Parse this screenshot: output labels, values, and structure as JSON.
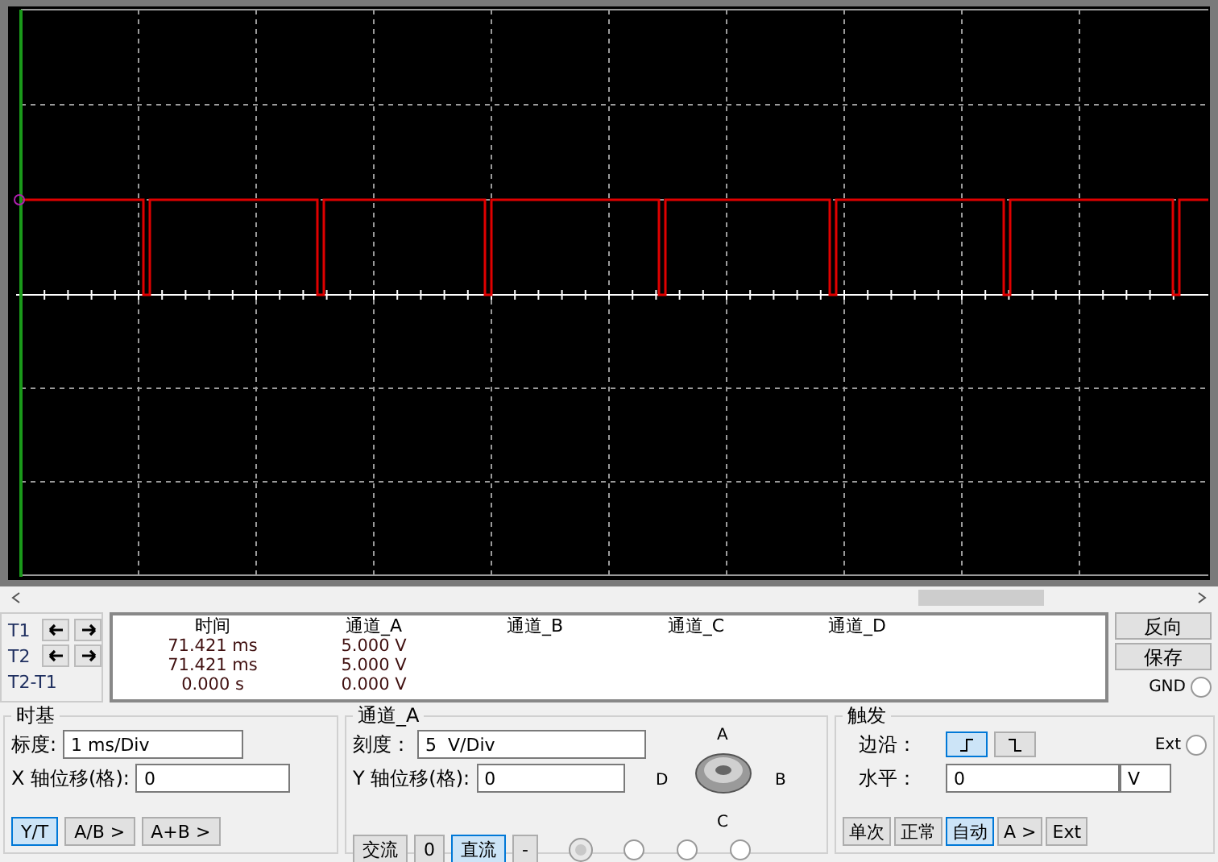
{
  "readout": {
    "columns": [
      "时间",
      "通道_A",
      "通道_B",
      "通道_C",
      "通道_D"
    ],
    "rows": [
      {
        "label": "T1",
        "values": [
          "71.421 ms",
          "5.000 V"
        ]
      },
      {
        "label": "T2",
        "values": [
          "71.421 ms",
          "5.000 V"
        ]
      },
      {
        "label": "T2-T1",
        "values": [
          "0.000 s",
          "0.000 V"
        ]
      }
    ]
  },
  "side_buttons": [
    "反向",
    "保存"
  ],
  "gnd": {
    "label": "GND",
    "selected": false
  },
  "timebase": {
    "title": "时基",
    "scale_label": "标度:",
    "scale": "1 ms/Div",
    "xpos_label": "X 轴位移(格):",
    "xpos": "0",
    "modes": [
      {
        "label": "Y/T",
        "selected": true
      },
      {
        "label": "A/B >",
        "selected": false
      },
      {
        "label": "A+B >",
        "selected": false
      }
    ]
  },
  "channel": {
    "title": "通道_A",
    "scale_label": "刻度：",
    "scale": "5  V/Div",
    "ypos_label": "Y 轴位移(格):",
    "ypos": "0",
    "coupling": [
      {
        "label": "交流",
        "selected": false
      },
      {
        "label": "0",
        "selected": false
      },
      {
        "label": "直流",
        "selected": true
      },
      {
        "label": "-",
        "selected": false
      }
    ],
    "knob_labels": [
      "A",
      "B",
      "C",
      "D"
    ],
    "channel_radios": [
      {
        "selected": true
      },
      {
        "selected": false
      },
      {
        "selected": false
      },
      {
        "selected": false
      }
    ]
  },
  "trigger": {
    "title": "触发",
    "edge_label": "边沿：",
    "edges": [
      {
        "kind": "rising",
        "selected": true
      },
      {
        "kind": "falling",
        "selected": false
      }
    ],
    "ext": {
      "label": "Ext",
      "selected": false
    },
    "level_label": "水平：",
    "level": "0",
    "unit": "V",
    "modes": [
      {
        "label": "单次",
        "selected": false
      },
      {
        "label": "正常",
        "selected": false
      },
      {
        "label": "自动",
        "selected": true
      },
      {
        "label": "A >",
        "selected": false
      },
      {
        "label": "Ext",
        "selected": false
      }
    ]
  }
}
